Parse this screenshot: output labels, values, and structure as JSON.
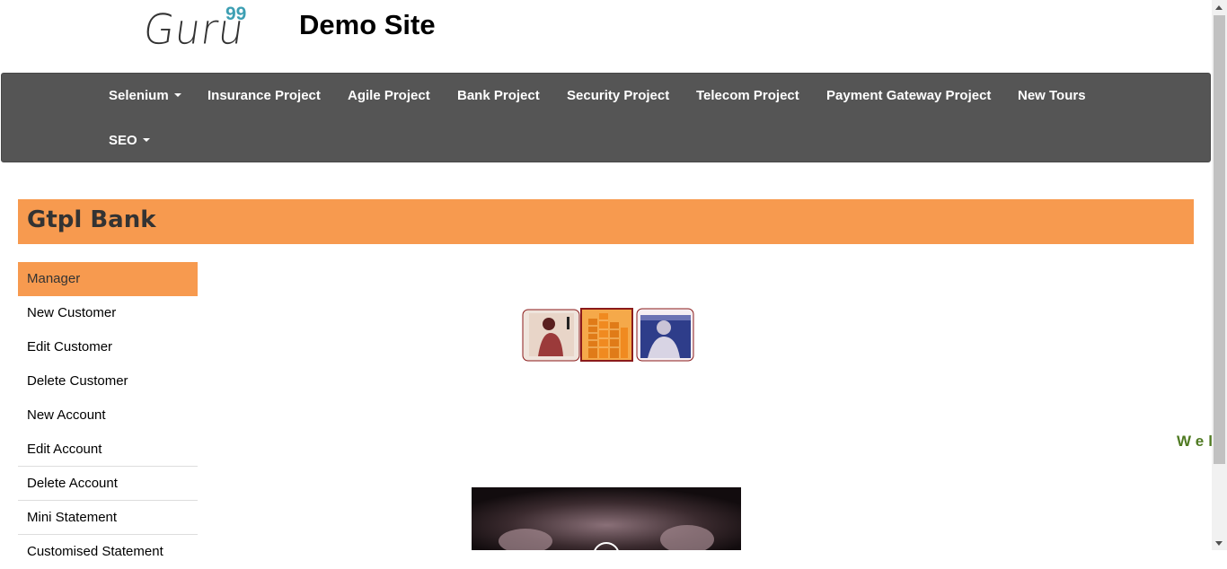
{
  "header": {
    "logo_text": "Guru",
    "logo_superscript": "99",
    "site_title": "Demo Site"
  },
  "nav": {
    "items": [
      {
        "label": "Selenium",
        "dropdown": true
      },
      {
        "label": "Insurance Project",
        "dropdown": false
      },
      {
        "label": "Agile Project",
        "dropdown": false
      },
      {
        "label": "Bank Project",
        "dropdown": false
      },
      {
        "label": "Security Project",
        "dropdown": false
      },
      {
        "label": "Telecom Project",
        "dropdown": false
      },
      {
        "label": "Payment Gateway Project",
        "dropdown": false
      },
      {
        "label": "New Tours",
        "dropdown": false
      },
      {
        "label": "SEO",
        "dropdown": true
      }
    ]
  },
  "bank": {
    "title": "Gtpl Bank"
  },
  "sidebar": {
    "items": [
      {
        "label": "Manager",
        "active": true
      },
      {
        "label": "New Customer"
      },
      {
        "label": "Edit Customer"
      },
      {
        "label": "Delete Customer"
      },
      {
        "label": "New Account"
      },
      {
        "label": "Edit Account"
      },
      {
        "label": "Delete Account"
      },
      {
        "label": "Mini Statement"
      },
      {
        "label": "Customised Statement"
      }
    ]
  },
  "marquee": {
    "text": "Wel"
  },
  "colors": {
    "accent": "#f79a4f",
    "navbar": "#555555",
    "welcome": "#4f7a22",
    "logo_sup": "#3d9fb3"
  }
}
